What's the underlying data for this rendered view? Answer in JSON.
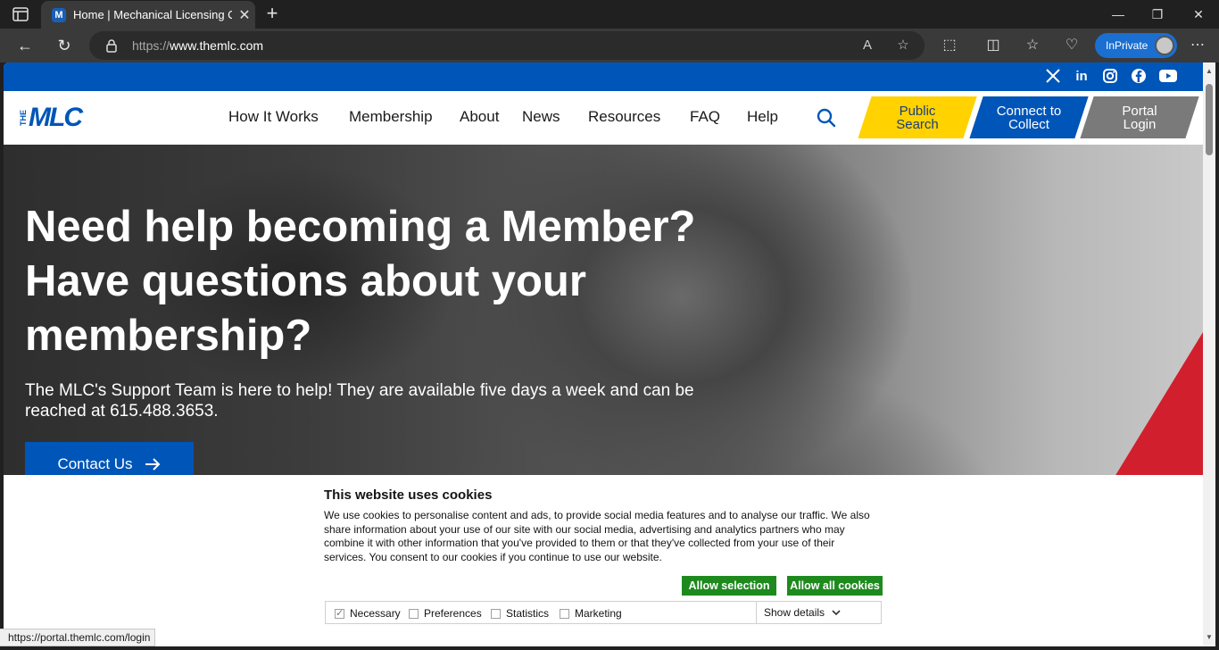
{
  "browser": {
    "tab_title": "Home | Mechanical Licensing Col",
    "url_protocol": "https://",
    "url_host": "www.themlc.com",
    "inprivate_label": "InPrivate"
  },
  "social": {
    "icons": [
      "x-icon",
      "linkedin-icon",
      "instagram-icon",
      "facebook-icon",
      "youtube-icon"
    ]
  },
  "header": {
    "logo_the": "THE",
    "logo_mlc": "MLC",
    "nav": [
      "How It Works",
      "Membership",
      "About",
      "News",
      "Resources",
      "FAQ",
      "Help"
    ],
    "cta_public": "Public Search",
    "cta_connect": "Connect to Collect",
    "cta_portal": "Portal Login"
  },
  "hero": {
    "title": "Need help becoming a Member? Have questions about your membership?",
    "subtitle": "The MLC's Support Team is here to help! They are available five days a week and can be reached at 615.488.3653.",
    "button": "Contact Us"
  },
  "cookies": {
    "title": "This website uses cookies",
    "body": "We use cookies to personalise content and ads, to provide social media features and to analyse our traffic. We also share information about your use of our site with our social media, advertising and analytics partners who may combine it with other information that you've provided to them or that they've collected from your use of their services. You consent to our cookies if you continue to use our website.",
    "allow_selection": "Allow selection",
    "allow_all": "Allow all cookies",
    "options": [
      {
        "label": "Necessary",
        "checked": true
      },
      {
        "label": "Preferences",
        "checked": false
      },
      {
        "label": "Statistics",
        "checked": false
      },
      {
        "label": "Marketing",
        "checked": false
      }
    ],
    "show_details": "Show details"
  },
  "status": {
    "link": "https://portal.themlc.com/login"
  },
  "colors": {
    "brand_blue": "#0055b8",
    "cta_yellow": "#ffd200",
    "cta_gray": "#7a7a7a",
    "accent_red": "#d11f2e",
    "cookie_green": "#1e8a1e"
  }
}
